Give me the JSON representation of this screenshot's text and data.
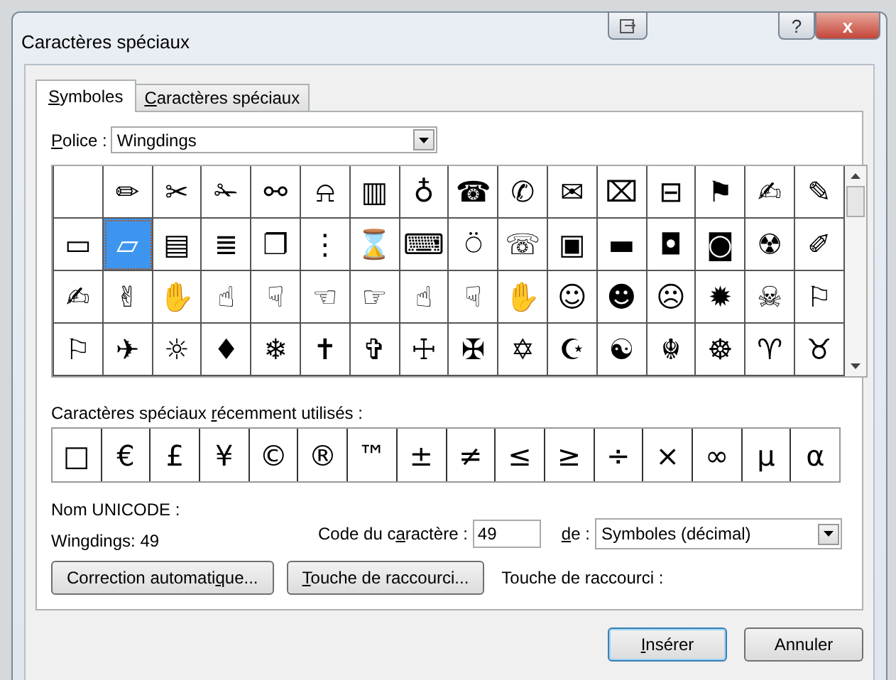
{
  "window": {
    "title": "Caractères spéciaux",
    "help_button": "?",
    "close_button": "x"
  },
  "tabs": [
    {
      "label": {
        "key": "S",
        "after": "ymboles"
      },
      "selected": true
    },
    {
      "label": {
        "key": "C",
        "after": "aractères spéciaux"
      },
      "selected": false
    }
  ],
  "font": {
    "label": {
      "key": "P",
      "after": "olice :"
    },
    "value": "Wingdings"
  },
  "symbol_grid": {
    "rows": [
      [
        {
          "selected": false
        },
        {
          "glyph": "✏",
          "selected": false
        },
        {
          "glyph": "✂",
          "selected": false
        },
        {
          "glyph": "✁",
          "selected": false
        },
        {
          "glyph": "⚯",
          "selected": false
        },
        {
          "glyph": "⍾",
          "selected": false
        },
        {
          "glyph": "▥",
          "selected": false
        },
        {
          "glyph": "♁",
          "selected": false
        },
        {
          "glyph": "☎",
          "selected": false
        },
        {
          "glyph": "✆",
          "selected": false
        },
        {
          "glyph": "✉",
          "selected": false
        },
        {
          "glyph": "⌧",
          "selected": false
        },
        {
          "glyph": "⊟",
          "selected": false
        },
        {
          "glyph": "⚑",
          "selected": false
        },
        {
          "glyph": "✍",
          "selected": false
        },
        {
          "glyph": "✎",
          "selected": false
        }
      ],
      [
        {
          "glyph": "▭",
          "selected": false
        },
        {
          "glyph": "▱",
          "selected": true
        },
        {
          "glyph": "▤",
          "selected": false
        },
        {
          "glyph": "≣",
          "selected": false
        },
        {
          "glyph": "❐",
          "selected": false
        },
        {
          "glyph": "⋮",
          "selected": false
        },
        {
          "glyph": "⌛",
          "selected": false
        },
        {
          "glyph": "⌨",
          "selected": false
        },
        {
          "glyph": "⍥",
          "selected": false
        },
        {
          "glyph": "☏",
          "selected": false
        },
        {
          "glyph": "▣",
          "selected": false
        },
        {
          "glyph": "▬",
          "selected": false
        },
        {
          "glyph": "◘",
          "selected": false
        },
        {
          "glyph": "◙",
          "selected": false
        },
        {
          "glyph": "☢",
          "selected": false
        },
        {
          "glyph": "✐",
          "selected": false
        }
      ],
      [
        {
          "glyph": "✍",
          "selected": false
        },
        {
          "glyph": "✌",
          "selected": false
        },
        {
          "glyph": "✋",
          "selected": false
        },
        {
          "glyph": "☝",
          "selected": false
        },
        {
          "glyph": "☟",
          "selected": false
        },
        {
          "glyph": "☜",
          "selected": false
        },
        {
          "glyph": "☞",
          "selected": false
        },
        {
          "glyph": "☝",
          "selected": false
        },
        {
          "glyph": "☟",
          "selected": false
        },
        {
          "glyph": "✋",
          "selected": false
        },
        {
          "glyph": "☺",
          "selected": false
        },
        {
          "glyph": "☻",
          "selected": false
        },
        {
          "glyph": "☹",
          "selected": false
        },
        {
          "glyph": "✹",
          "selected": false
        },
        {
          "glyph": "☠",
          "selected": false
        },
        {
          "glyph": "⚐",
          "selected": false
        }
      ],
      [
        {
          "glyph": "⚐",
          "selected": false
        },
        {
          "glyph": "✈",
          "selected": false
        },
        {
          "glyph": "☼",
          "selected": false
        },
        {
          "glyph": "♦",
          "selected": false
        },
        {
          "glyph": "❄",
          "selected": false
        },
        {
          "glyph": "✝",
          "selected": false
        },
        {
          "glyph": "✞",
          "selected": false
        },
        {
          "glyph": "☩",
          "selected": false
        },
        {
          "glyph": "✠",
          "selected": false
        },
        {
          "glyph": "✡",
          "selected": false
        },
        {
          "glyph": "☪",
          "selected": false
        },
        {
          "glyph": "☯",
          "selected": false
        },
        {
          "glyph": "☬",
          "selected": false
        },
        {
          "glyph": "☸",
          "selected": false
        },
        {
          "glyph": "♈",
          "selected": false
        },
        {
          "glyph": "♉",
          "selected": false
        }
      ]
    ]
  },
  "recent": {
    "label": {
      "before": "Caractères spéciaux ",
      "key": "r",
      "after": "écemment utilisés :"
    },
    "symbols": [
      "□",
      "€",
      "£",
      "¥",
      "©",
      "®",
      "™",
      "±",
      "≠",
      "≤",
      "≥",
      "÷",
      "×",
      "∞",
      "μ",
      "α"
    ]
  },
  "unicode_name": {
    "label": "Nom UNICODE :",
    "value": "Wingdings: 49"
  },
  "char_code": {
    "label": {
      "before": "Code du c",
      "key": "a",
      "after": "ractère :"
    },
    "value": "49"
  },
  "from": {
    "label": {
      "key": "d",
      "after": "e :"
    },
    "value": "Symboles (décimal)"
  },
  "buttons": [
    {
      "label": {
        "before": "Correction automati",
        "key": "q",
        "after": "ue..."
      }
    },
    {
      "label": {
        "key": "T",
        "after": "ouche de raccourci..."
      }
    }
  ],
  "shortcut_label": "Touche de raccourci :",
  "footer_buttons": [
    {
      "label": {
        "key": "I",
        "after": "nsérer"
      },
      "default": true
    },
    {
      "label": {
        "before": "Annuler"
      },
      "default": false
    }
  ]
}
